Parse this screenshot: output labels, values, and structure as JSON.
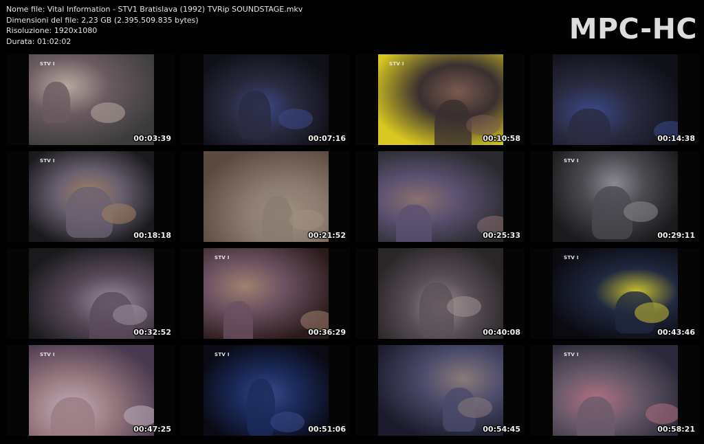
{
  "file_info": {
    "name": "Nome file: Vital Information - STV1 Bratislava (1992) TVRip SOUNDSTAGE.mkv",
    "size": "Dimensioni del file: 2,23 GB (2.395.509.835 bytes)",
    "resolution": "Risoluzione: 1920x1080",
    "duration": "Durata: 01:02:02"
  },
  "logo": "MPC-HC",
  "thumbnails": [
    {
      "timestamp": "00:03:39",
      "channel_logo": "STV I",
      "colors": [
        "#3a3b3a",
        "#6a5a60",
        "#b8a8a0"
      ]
    },
    {
      "timestamp": "00:07:16",
      "channel_logo": "",
      "colors": [
        "#101018",
        "#2a2a40",
        "#3a4a8a"
      ]
    },
    {
      "timestamp": "00:10:58",
      "channel_logo": "STV I",
      "colors": [
        "#d8c820",
        "#3a3030",
        "#7a5a50"
      ]
    },
    {
      "timestamp": "00:14:38",
      "channel_logo": "",
      "colors": [
        "#101018",
        "#2a2a40",
        "#3a4a8a"
      ]
    },
    {
      "timestamp": "00:18:18",
      "channel_logo": "STV I",
      "colors": [
        "#1a1a1e",
        "#6a6070",
        "#a08060"
      ]
    },
    {
      "timestamp": "00:21:52",
      "channel_logo": "",
      "colors": [
        "#5a4a40",
        "#8a7a70",
        "#a09080"
      ]
    },
    {
      "timestamp": "00:25:33",
      "channel_logo": "",
      "colors": [
        "#2a2a2e",
        "#5a5070",
        "#8a7070"
      ]
    },
    {
      "timestamp": "00:29:11",
      "channel_logo": "STV I",
      "colors": [
        "#1a1a1c",
        "#4a4a50",
        "#8a8a90"
      ]
    },
    {
      "timestamp": "00:32:52",
      "channel_logo": "",
      "colors": [
        "#1a1a1e",
        "#5a4a5a",
        "#9a90a0"
      ]
    },
    {
      "timestamp": "00:36:29",
      "channel_logo": "STV I",
      "colors": [
        "#2a1a1a",
        "#6a5060",
        "#a08070"
      ]
    },
    {
      "timestamp": "00:40:08",
      "channel_logo": "",
      "colors": [
        "#2a2628",
        "#5a5058",
        "#a09090"
      ]
    },
    {
      "timestamp": "00:43:46",
      "channel_logo": "STV I",
      "colors": [
        "#0a0a10",
        "#202840",
        "#c8c030"
      ]
    },
    {
      "timestamp": "00:47:25",
      "channel_logo": "STV I",
      "colors": [
        "#4a3a50",
        "#9a7a80",
        "#c0b0c0"
      ]
    },
    {
      "timestamp": "00:51:06",
      "channel_logo": "STV I",
      "colors": [
        "#0a0a14",
        "#1a2a5a",
        "#3a4a8a"
      ]
    },
    {
      "timestamp": "00:54:45",
      "channel_logo": "",
      "colors": [
        "#1a1a2a",
        "#4a4a6a",
        "#8a7a7a"
      ]
    },
    {
      "timestamp": "00:58:21",
      "channel_logo": "STV I",
      "colors": [
        "#2a2a3a",
        "#6a5a6a",
        "#b07080"
      ]
    }
  ]
}
